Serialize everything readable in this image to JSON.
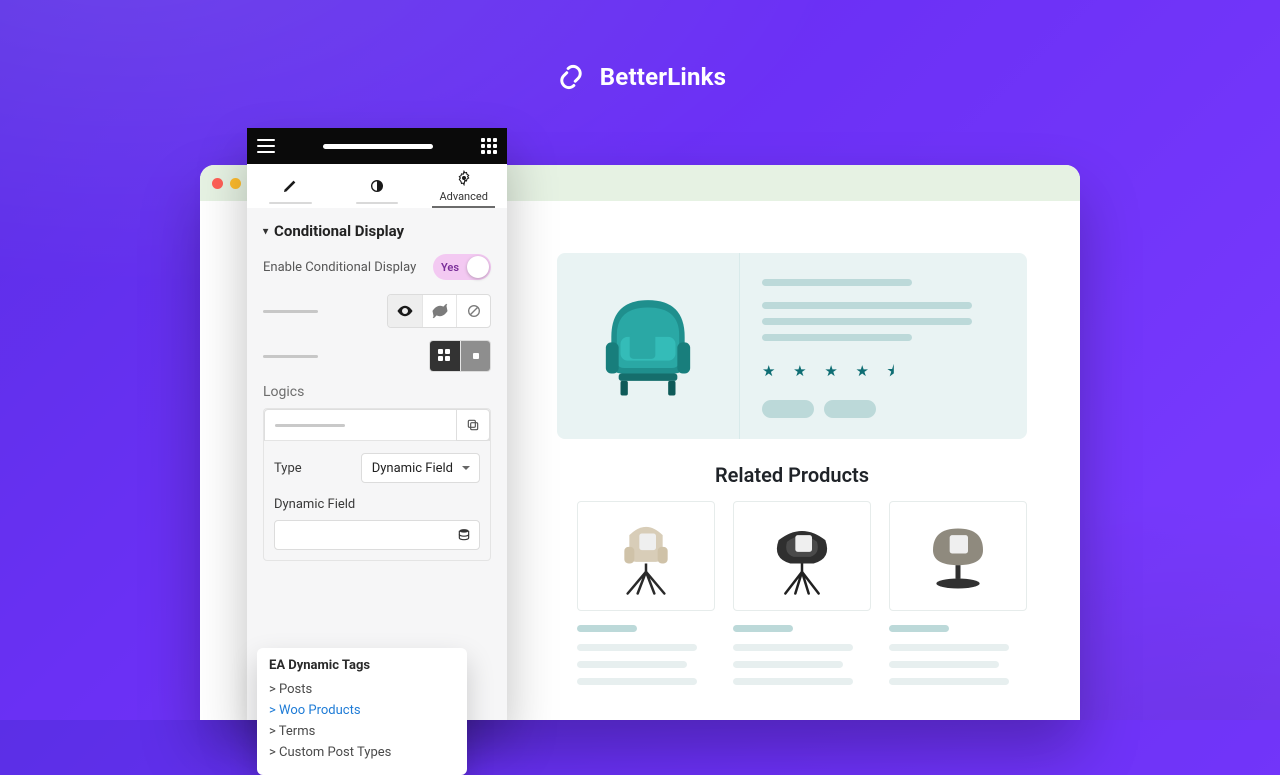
{
  "brand": {
    "name": "BetterLinks"
  },
  "tabs": {
    "advanced": "Advanced"
  },
  "section": {
    "title": "Conditional Display"
  },
  "enable": {
    "label": "Enable Conditional Display",
    "state": "Yes"
  },
  "logics": {
    "heading": "Logics",
    "type_label": "Type",
    "type_value": "Dynamic Field",
    "dynamic_field_label": "Dynamic Field"
  },
  "dropdown": {
    "heading": "EA Dynamic Tags",
    "items": [
      {
        "label": "> Posts",
        "selected": false
      },
      {
        "label": "> Woo Products",
        "selected": true
      },
      {
        "label": "> Terms",
        "selected": false
      },
      {
        "label": "> Custom Post Types",
        "selected": false
      }
    ]
  },
  "related": {
    "title": "Related Products"
  },
  "product": {
    "rating": 4.5
  }
}
